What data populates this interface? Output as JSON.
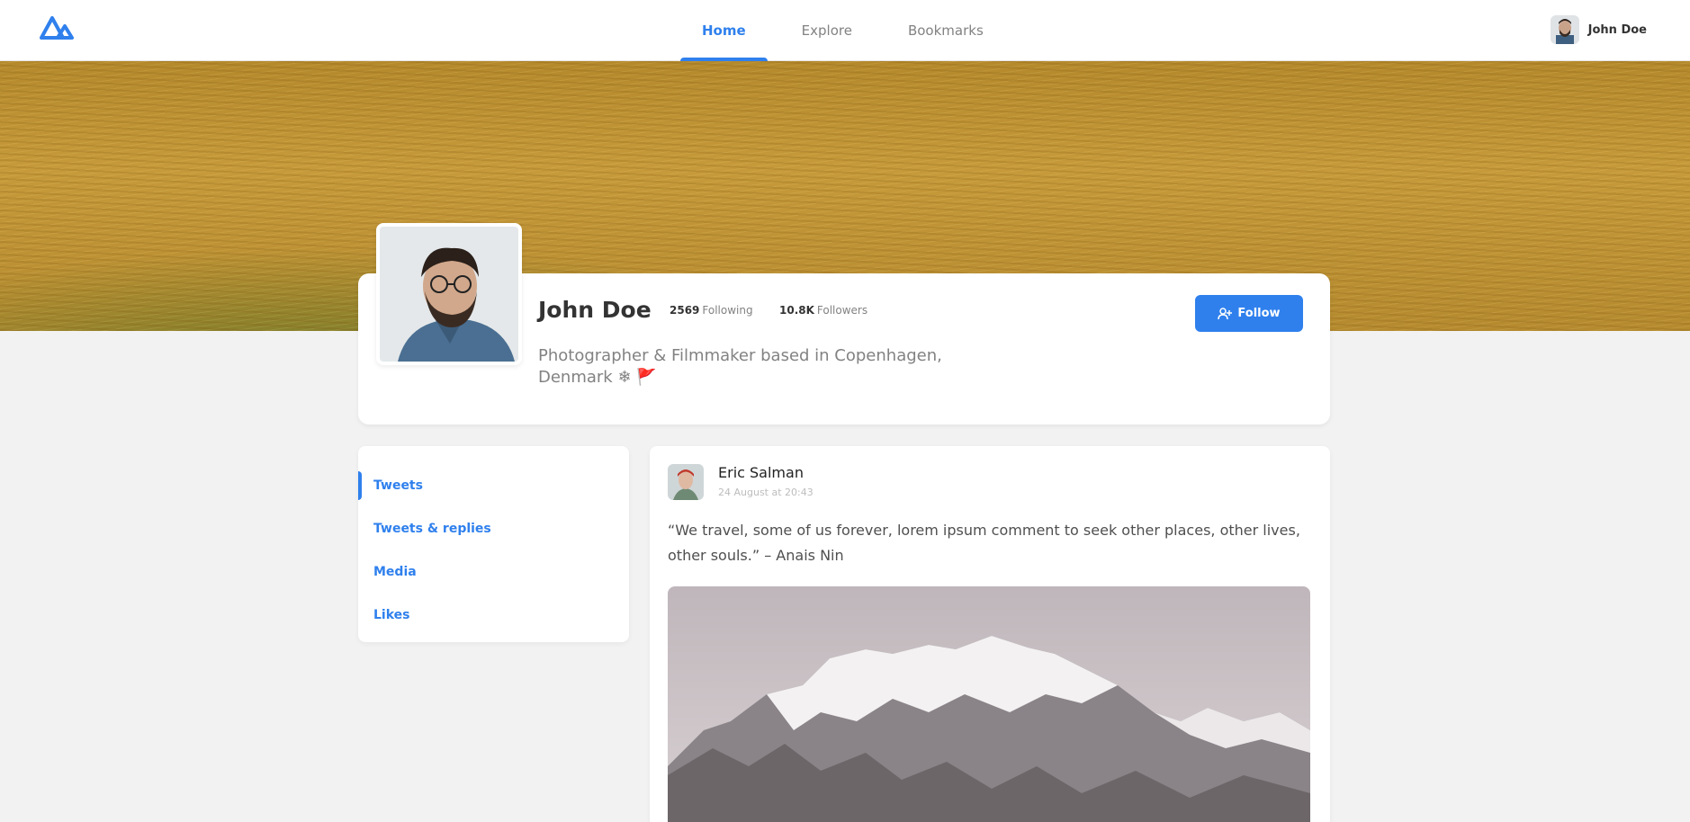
{
  "nav": {
    "logo_icon": "mountain-logo-icon",
    "tabs": [
      {
        "label": "Home",
        "active": true
      },
      {
        "label": "Explore",
        "active": false
      },
      {
        "label": "Bookmarks",
        "active": false
      }
    ],
    "user_name": "John Doe"
  },
  "profile": {
    "name": "John Doe",
    "following_count": "2569",
    "following_label": "Following",
    "followers_count": "10.8K",
    "followers_label": "Followers",
    "bio_line1": "Photographer & Filmmaker based in Copenhagen,",
    "bio_line2": "Denmark ❄ 🚩",
    "follow_label": "Follow"
  },
  "filters": [
    {
      "label": "Tweets",
      "active": true
    },
    {
      "label": "Tweets & replies",
      "active": false
    },
    {
      "label": "Media",
      "active": false
    },
    {
      "label": "Likes",
      "active": false
    }
  ],
  "tweet": {
    "author": "Eric Salman",
    "time": "24 August at 20:43",
    "text": "“We travel, some of us forever, lorem ipsum comment to seek other places, other lives, other souls.” – Anais Nin"
  },
  "colors": {
    "accent": "#2F80ED",
    "background": "#F2F2F2",
    "muted_text": "#828282"
  }
}
